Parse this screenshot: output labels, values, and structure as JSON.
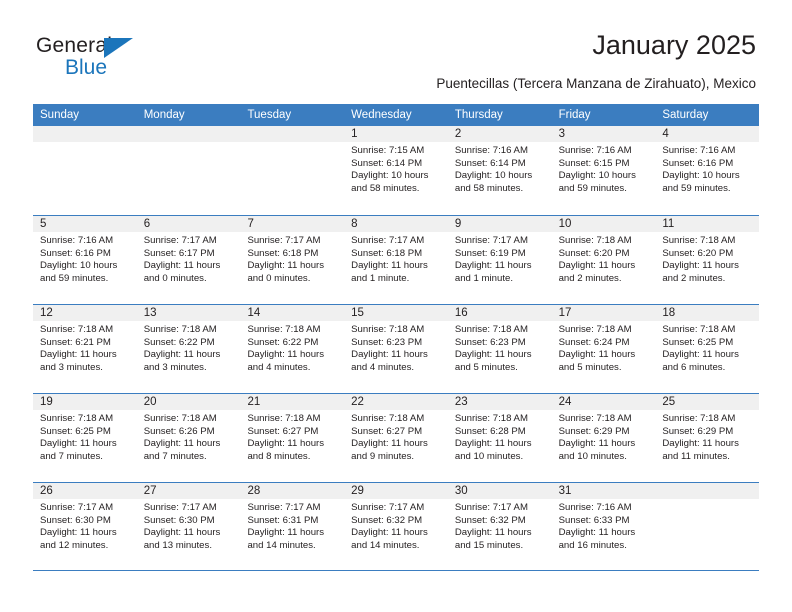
{
  "brand": {
    "line1": "General",
    "line2": "Blue",
    "triangle_color": "#1b75bb"
  },
  "header": {
    "title": "January 2025",
    "subtitle": "Puentecillas (Tercera Manzana de Zirahuato), Mexico"
  },
  "colors": {
    "header_blue": "#3b7dc0",
    "band_gray": "#f0f0f0",
    "text": "#231f20"
  },
  "weekdays": [
    "Sunday",
    "Monday",
    "Tuesday",
    "Wednesday",
    "Thursday",
    "Friday",
    "Saturday"
  ],
  "weeks": [
    [
      {
        "day": "",
        "empty": true
      },
      {
        "day": "",
        "empty": true
      },
      {
        "day": "",
        "empty": true
      },
      {
        "day": "1",
        "sunrise": "Sunrise: 7:15 AM",
        "sunset": "Sunset: 6:14 PM",
        "daylight1": "Daylight: 10 hours",
        "daylight2": "and 58 minutes."
      },
      {
        "day": "2",
        "sunrise": "Sunrise: 7:16 AM",
        "sunset": "Sunset: 6:14 PM",
        "daylight1": "Daylight: 10 hours",
        "daylight2": "and 58 minutes."
      },
      {
        "day": "3",
        "sunrise": "Sunrise: 7:16 AM",
        "sunset": "Sunset: 6:15 PM",
        "daylight1": "Daylight: 10 hours",
        "daylight2": "and 59 minutes."
      },
      {
        "day": "4",
        "sunrise": "Sunrise: 7:16 AM",
        "sunset": "Sunset: 6:16 PM",
        "daylight1": "Daylight: 10 hours",
        "daylight2": "and 59 minutes."
      }
    ],
    [
      {
        "day": "5",
        "sunrise": "Sunrise: 7:16 AM",
        "sunset": "Sunset: 6:16 PM",
        "daylight1": "Daylight: 10 hours",
        "daylight2": "and 59 minutes."
      },
      {
        "day": "6",
        "sunrise": "Sunrise: 7:17 AM",
        "sunset": "Sunset: 6:17 PM",
        "daylight1": "Daylight: 11 hours",
        "daylight2": "and 0 minutes."
      },
      {
        "day": "7",
        "sunrise": "Sunrise: 7:17 AM",
        "sunset": "Sunset: 6:18 PM",
        "daylight1": "Daylight: 11 hours",
        "daylight2": "and 0 minutes."
      },
      {
        "day": "8",
        "sunrise": "Sunrise: 7:17 AM",
        "sunset": "Sunset: 6:18 PM",
        "daylight1": "Daylight: 11 hours",
        "daylight2": "and 1 minute."
      },
      {
        "day": "9",
        "sunrise": "Sunrise: 7:17 AM",
        "sunset": "Sunset: 6:19 PM",
        "daylight1": "Daylight: 11 hours",
        "daylight2": "and 1 minute."
      },
      {
        "day": "10",
        "sunrise": "Sunrise: 7:18 AM",
        "sunset": "Sunset: 6:20 PM",
        "daylight1": "Daylight: 11 hours",
        "daylight2": "and 2 minutes."
      },
      {
        "day": "11",
        "sunrise": "Sunrise: 7:18 AM",
        "sunset": "Sunset: 6:20 PM",
        "daylight1": "Daylight: 11 hours",
        "daylight2": "and 2 minutes."
      }
    ],
    [
      {
        "day": "12",
        "sunrise": "Sunrise: 7:18 AM",
        "sunset": "Sunset: 6:21 PM",
        "daylight1": "Daylight: 11 hours",
        "daylight2": "and 3 minutes."
      },
      {
        "day": "13",
        "sunrise": "Sunrise: 7:18 AM",
        "sunset": "Sunset: 6:22 PM",
        "daylight1": "Daylight: 11 hours",
        "daylight2": "and 3 minutes."
      },
      {
        "day": "14",
        "sunrise": "Sunrise: 7:18 AM",
        "sunset": "Sunset: 6:22 PM",
        "daylight1": "Daylight: 11 hours",
        "daylight2": "and 4 minutes."
      },
      {
        "day": "15",
        "sunrise": "Sunrise: 7:18 AM",
        "sunset": "Sunset: 6:23 PM",
        "daylight1": "Daylight: 11 hours",
        "daylight2": "and 4 minutes."
      },
      {
        "day": "16",
        "sunrise": "Sunrise: 7:18 AM",
        "sunset": "Sunset: 6:23 PM",
        "daylight1": "Daylight: 11 hours",
        "daylight2": "and 5 minutes."
      },
      {
        "day": "17",
        "sunrise": "Sunrise: 7:18 AM",
        "sunset": "Sunset: 6:24 PM",
        "daylight1": "Daylight: 11 hours",
        "daylight2": "and 5 minutes."
      },
      {
        "day": "18",
        "sunrise": "Sunrise: 7:18 AM",
        "sunset": "Sunset: 6:25 PM",
        "daylight1": "Daylight: 11 hours",
        "daylight2": "and 6 minutes."
      }
    ],
    [
      {
        "day": "19",
        "sunrise": "Sunrise: 7:18 AM",
        "sunset": "Sunset: 6:25 PM",
        "daylight1": "Daylight: 11 hours",
        "daylight2": "and 7 minutes."
      },
      {
        "day": "20",
        "sunrise": "Sunrise: 7:18 AM",
        "sunset": "Sunset: 6:26 PM",
        "daylight1": "Daylight: 11 hours",
        "daylight2": "and 7 minutes."
      },
      {
        "day": "21",
        "sunrise": "Sunrise: 7:18 AM",
        "sunset": "Sunset: 6:27 PM",
        "daylight1": "Daylight: 11 hours",
        "daylight2": "and 8 minutes."
      },
      {
        "day": "22",
        "sunrise": "Sunrise: 7:18 AM",
        "sunset": "Sunset: 6:27 PM",
        "daylight1": "Daylight: 11 hours",
        "daylight2": "and 9 minutes."
      },
      {
        "day": "23",
        "sunrise": "Sunrise: 7:18 AM",
        "sunset": "Sunset: 6:28 PM",
        "daylight1": "Daylight: 11 hours",
        "daylight2": "and 10 minutes."
      },
      {
        "day": "24",
        "sunrise": "Sunrise: 7:18 AM",
        "sunset": "Sunset: 6:29 PM",
        "daylight1": "Daylight: 11 hours",
        "daylight2": "and 10 minutes."
      },
      {
        "day": "25",
        "sunrise": "Sunrise: 7:18 AM",
        "sunset": "Sunset: 6:29 PM",
        "daylight1": "Daylight: 11 hours",
        "daylight2": "and 11 minutes."
      }
    ],
    [
      {
        "day": "26",
        "sunrise": "Sunrise: 7:17 AM",
        "sunset": "Sunset: 6:30 PM",
        "daylight1": "Daylight: 11 hours",
        "daylight2": "and 12 minutes."
      },
      {
        "day": "27",
        "sunrise": "Sunrise: 7:17 AM",
        "sunset": "Sunset: 6:30 PM",
        "daylight1": "Daylight: 11 hours",
        "daylight2": "and 13 minutes."
      },
      {
        "day": "28",
        "sunrise": "Sunrise: 7:17 AM",
        "sunset": "Sunset: 6:31 PM",
        "daylight1": "Daylight: 11 hours",
        "daylight2": "and 14 minutes."
      },
      {
        "day": "29",
        "sunrise": "Sunrise: 7:17 AM",
        "sunset": "Sunset: 6:32 PM",
        "daylight1": "Daylight: 11 hours",
        "daylight2": "and 14 minutes."
      },
      {
        "day": "30",
        "sunrise": "Sunrise: 7:17 AM",
        "sunset": "Sunset: 6:32 PM",
        "daylight1": "Daylight: 11 hours",
        "daylight2": "and 15 minutes."
      },
      {
        "day": "31",
        "sunrise": "Sunrise: 7:16 AM",
        "sunset": "Sunset: 6:33 PM",
        "daylight1": "Daylight: 11 hours",
        "daylight2": "and 16 minutes."
      },
      {
        "day": "",
        "empty": true
      }
    ]
  ]
}
